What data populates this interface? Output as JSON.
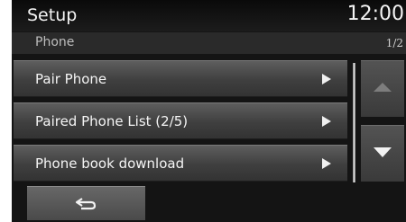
{
  "header": {
    "title": "Setup",
    "clock": "12:00"
  },
  "subheader": {
    "section": "Phone",
    "page": "1/2"
  },
  "menu": {
    "items": [
      {
        "label": "Pair Phone"
      },
      {
        "label": "Paired Phone List  (2/5)"
      },
      {
        "label": "Phone book download"
      }
    ]
  },
  "icons": {
    "item_arrow": "play-arrow-icon",
    "scroll_up": "triangle-up-icon",
    "scroll_down": "triangle-down-icon",
    "back": "return-arrow-icon"
  },
  "colors": {
    "background": "#141414",
    "text": "#f2f2f2",
    "button": "#4a4a4a"
  }
}
